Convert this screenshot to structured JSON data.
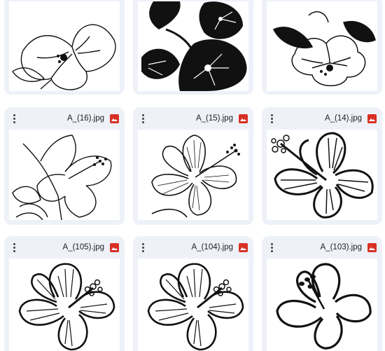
{
  "files": [
    {
      "name": ""
    },
    {
      "name": ""
    },
    {
      "name": ""
    },
    {
      "name": "A_(16).jpg"
    },
    {
      "name": "A_(15).jpg"
    },
    {
      "name": "A_(14).jpg"
    },
    {
      "name": "A_(105).jpg"
    },
    {
      "name": "A_(104).jpg"
    },
    {
      "name": "A_(103).jpg"
    }
  ],
  "icons": {
    "more": "more-vert-icon",
    "image": "image-file-icon",
    "image_color": "#d93025"
  },
  "colors": {
    "card_bg": "#eef1f8",
    "page_bg": "#ffffff"
  }
}
